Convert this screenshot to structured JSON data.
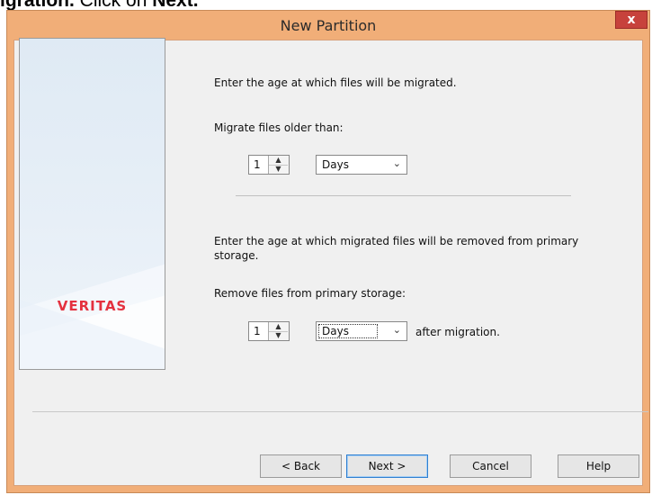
{
  "doc_fragment": {
    "lead": "igration.",
    "rest": " Click on ",
    "bold_end": "Next."
  },
  "window": {
    "title": "New Partition",
    "close_glyph": "x"
  },
  "side_panel": {
    "logo": "VERITAS"
  },
  "section1": {
    "instruction": "Enter the age at which files will be migrated.",
    "label": "Migrate files older than:",
    "spin_value": "1",
    "unit": "Days"
  },
  "section2": {
    "instruction_line1": "Enter the age at which migrated files will be removed from primary",
    "instruction_line2": "storage.",
    "label": "Remove files from primary storage:",
    "spin_value": "1",
    "unit": "Days",
    "suffix": "after migration."
  },
  "buttons": {
    "back": "< Back",
    "next": "Next >",
    "cancel": "Cancel",
    "help": "Help"
  },
  "icons": {
    "spin_up": "chevron-up-icon",
    "spin_down": "chevron-down-icon",
    "dropdown": "chevron-down-icon"
  }
}
